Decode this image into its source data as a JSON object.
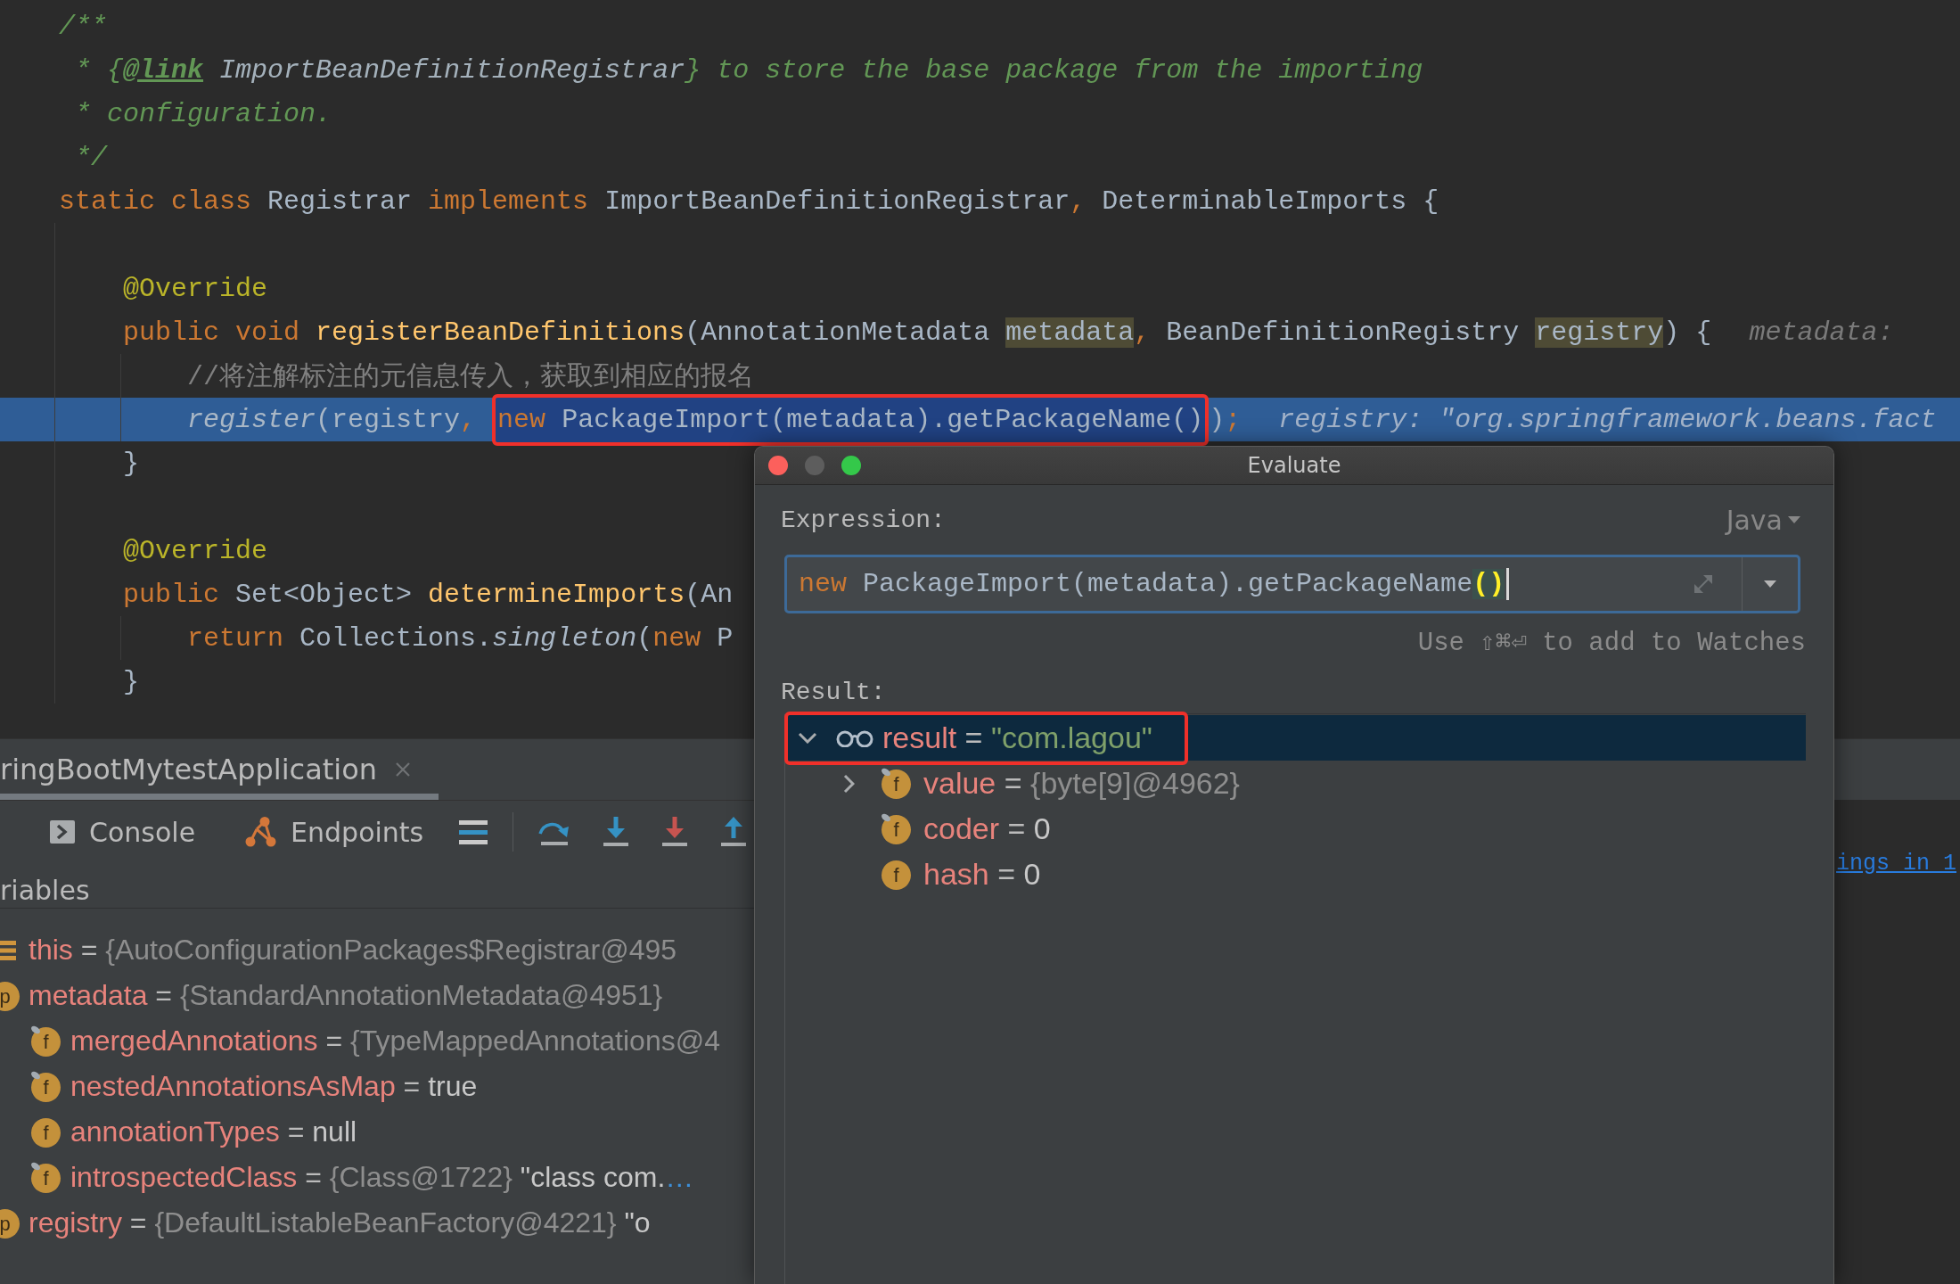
{
  "editor": {
    "lines": [
      {
        "current": false,
        "segments": [
          {
            "kind": "doc",
            "text": "/**"
          }
        ]
      },
      {
        "current": false,
        "segments": [
          {
            "kind": "doc",
            "text": " * {"
          },
          {
            "kind": "doc_tag",
            "text": "@link"
          },
          {
            "kind": "doc_ref",
            "text": " ImportBeanDefinitionRegistrar"
          },
          {
            "kind": "doc",
            "text": "} to store the base package from the importing"
          }
        ]
      },
      {
        "current": false,
        "segments": [
          {
            "kind": "doc",
            "text": " * configuration."
          }
        ]
      },
      {
        "current": false,
        "segments": [
          {
            "kind": "doc",
            "text": " */"
          }
        ]
      },
      {
        "current": false,
        "segments": [
          {
            "kind": "keyword",
            "text": "static class"
          },
          {
            "kind": "plain",
            "text": " Registrar "
          },
          {
            "kind": "keyword",
            "text": "implements"
          },
          {
            "kind": "plain",
            "text": " ImportBeanDefinitionRegistrar"
          },
          {
            "kind": "keyword",
            "text": ","
          },
          {
            "kind": "plain",
            "text": " DeterminableImports {"
          }
        ]
      },
      {
        "current": false
      },
      {
        "current": false,
        "segments": [
          {
            "kind": "annotation",
            "text": "    @Override"
          }
        ]
      },
      {
        "current": false,
        "segments": [
          {
            "kind": "keyword",
            "text": "    public void "
          },
          {
            "kind": "method",
            "text": "registerBeanDefinitions"
          },
          {
            "kind": "plain",
            "text": "(AnnotationMetadata "
          },
          {
            "kind": "param_highlight",
            "text": "metadata"
          },
          {
            "kind": "keyword",
            "text": ","
          },
          {
            "kind": "plain",
            "text": " BeanDefinitionRegistry "
          },
          {
            "kind": "param_highlight",
            "text": "registry"
          },
          {
            "kind": "plain",
            "text": ") {"
          },
          {
            "kind": "hint",
            "text": "metadata:"
          }
        ]
      },
      {
        "current": false,
        "segments": [
          {
            "kind": "comment",
            "text": "        //将注解标注的元信息传入，获取到相应的报名"
          }
        ]
      },
      {
        "current": true,
        "segments": [
          {
            "kind": "italic",
            "text": "        register"
          },
          {
            "kind": "plain",
            "text": "(registry"
          },
          {
            "kind": "keyword",
            "text": ", "
          },
          {
            "kind": "selection",
            "outlined": true,
            "segments": [
              {
                "kind": "keyword",
                "text": "new"
              },
              {
                "kind": "plain",
                "text": " PackageImport(metadata).getPackageName()"
              }
            ]
          },
          {
            "kind": "plain",
            "text": ")"
          },
          {
            "kind": "keyword",
            "text": ";"
          },
          {
            "kind": "hint",
            "text": "registry: \"org.springframework.beans.fact"
          }
        ]
      },
      {
        "current": false,
        "segments": [
          {
            "kind": "plain",
            "text": "    }"
          }
        ]
      },
      {
        "current": false
      },
      {
        "current": false,
        "segments": [
          {
            "kind": "annotation",
            "text": "    @Override"
          }
        ]
      },
      {
        "current": false,
        "segments": [
          {
            "kind": "keyword",
            "text": "    public"
          },
          {
            "kind": "plain",
            "text": " Set<Object> "
          },
          {
            "kind": "method",
            "text": "determineImports"
          },
          {
            "kind": "plain",
            "text": "(An"
          }
        ]
      },
      {
        "current": false,
        "segments": [
          {
            "kind": "keyword",
            "text": "        return"
          },
          {
            "kind": "plain",
            "text": " Collections."
          },
          {
            "kind": "italic",
            "text": "singleton"
          },
          {
            "kind": "plain",
            "text": "("
          },
          {
            "kind": "keyword",
            "text": "new"
          },
          {
            "kind": "plain",
            "text": " P"
          }
        ]
      },
      {
        "current": false,
        "segments": [
          {
            "kind": "plain",
            "text": "    }"
          }
        ]
      }
    ]
  },
  "debug_panel": {
    "session_tab": {
      "label": "ringBootMytestApplication",
      "selected": true
    },
    "tool_tabs": [
      {
        "kind": "console",
        "label": "Console"
      },
      {
        "kind": "endpoints",
        "label": "Endpoints"
      }
    ],
    "variables": {
      "title": "riables",
      "items": [
        {
          "kind": "object",
          "name": "this",
          "op": "=",
          "value": {
            "kind": "ref",
            "text": "{AutoConfigurationPackages$Registrar@495"
          },
          "final": false
        },
        {
          "kind": "badge",
          "badge": "p",
          "name": "metadata",
          "op": "=",
          "value": {
            "kind": "ref",
            "text": "{StandardAnnotationMetadata@4951}"
          },
          "children": [
            {
              "kind": "badge",
              "badge": "f",
              "name": "mergedAnnotations",
              "op": "=",
              "value": {
                "kind": "ref",
                "text": "{TypeMappedAnnotations@4"
              },
              "final": true
            },
            {
              "kind": "badge",
              "badge": "f",
              "name": "nestedAnnotationsAsMap",
              "op": "=",
              "value": {
                "kind": "literal",
                "text": "true"
              },
              "final": true
            },
            {
              "kind": "badge",
              "badge": "f",
              "name": "annotationTypes",
              "op": "=",
              "value": {
                "kind": "literal",
                "text": "null"
              },
              "final": false
            },
            {
              "kind": "badge",
              "badge": "f",
              "name": "introspectedClass",
              "op": "=",
              "value": {
                "kind": "ref",
                "text": "{Class@1722}"
              },
              "detail": "\"class com.",
              "more": "…",
              "final": true
            }
          ]
        },
        {
          "kind": "badge",
          "badge": "p",
          "name": "registry",
          "op": "=",
          "value": {
            "kind": "ref",
            "text": "{DefaultListableBeanFactory@4221}"
          },
          "detail": "\"o"
        }
      ]
    }
  },
  "console": {
    "link": "ings in 1"
  },
  "evaluate_dialog": {
    "title": "Evaluate",
    "window_controls": [
      {
        "kind": "close",
        "disabled": false
      },
      {
        "kind": "minimize",
        "disabled": true
      },
      {
        "kind": "zoom",
        "disabled": false
      }
    ],
    "expression_label": "Expression:",
    "language": "Java",
    "expression": {
      "segments": [
        {
          "kind": "keyword",
          "text": "new"
        },
        {
          "kind": "plain",
          "text": " PackageImport(metadata).getPackageName"
        },
        {
          "kind": "brace_match",
          "text": "()"
        }
      ]
    },
    "watch_hint": "Use ⇧⌘⏎ to add to Watches",
    "result_label": "Result:",
    "result_tree": [
      {
        "kind": "watch",
        "name": "result",
        "op": "=",
        "value": {
          "kind": "string",
          "text": "\"com.lagou\""
        },
        "selected": true,
        "outlined": true,
        "expanded": true,
        "children": [
          {
            "kind": "badge",
            "badge": "f",
            "name": "value",
            "op": "=",
            "value": {
              "kind": "ref",
              "text": "{byte[9]@4962}"
            },
            "final": true,
            "selected": false,
            "outlined": false,
            "expanded": false
          },
          {
            "kind": "badge",
            "badge": "f",
            "name": "coder",
            "op": "=",
            "value": {
              "kind": "literal",
              "text": "0"
            },
            "final": true,
            "selected": false,
            "outlined": false
          },
          {
            "kind": "badge",
            "badge": "f",
            "name": "hash",
            "op": "=",
            "value": {
              "kind": "literal",
              "text": "0"
            },
            "final": false,
            "selected": false,
            "outlined": false
          }
        ]
      }
    ]
  }
}
